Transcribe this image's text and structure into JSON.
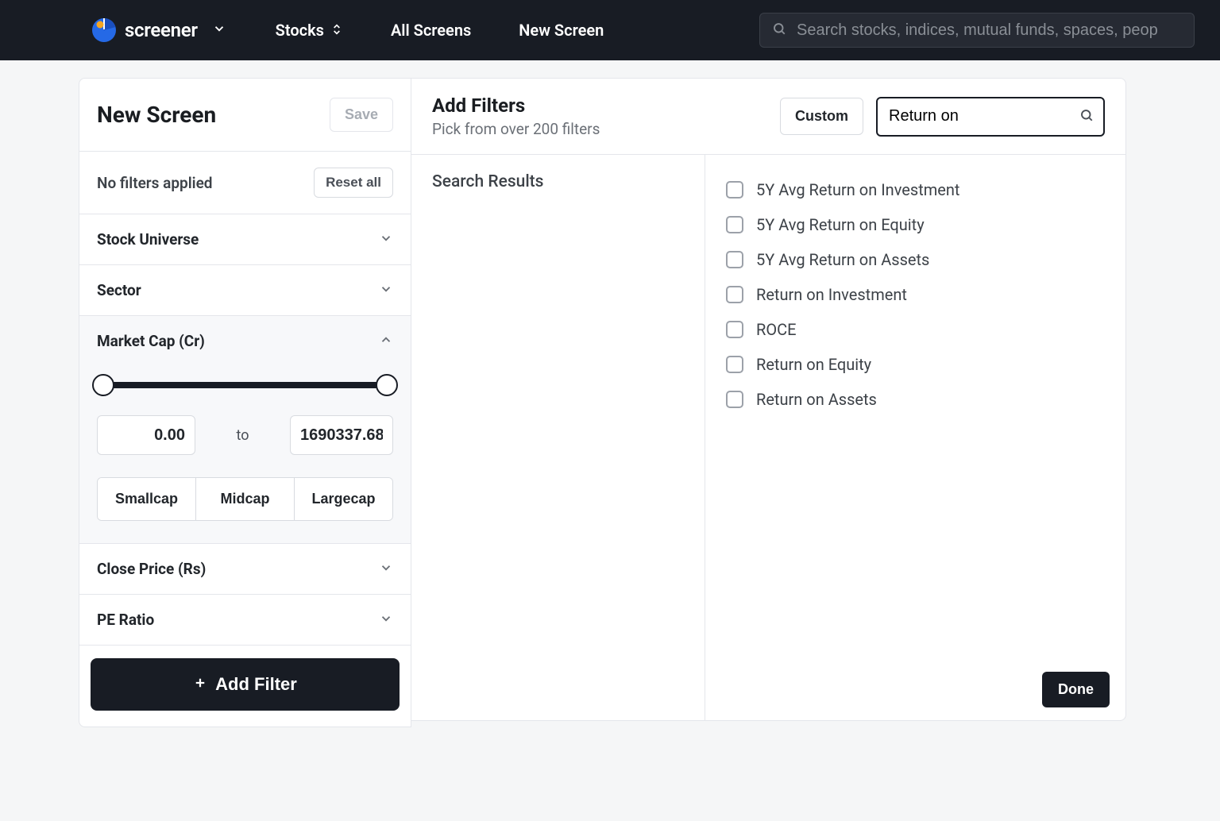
{
  "brand": "screener",
  "nav": {
    "stocks": "Stocks",
    "all_screens": "All Screens",
    "new_screen": "New Screen"
  },
  "search_placeholder": "Search stocks, indices, mutual funds, spaces, peop",
  "left": {
    "title": "New Screen",
    "save": "Save",
    "no_filters": "No filters applied",
    "reset": "Reset all",
    "sections": {
      "stock_universe": "Stock Universe",
      "sector": "Sector",
      "market_cap": "Market Cap (Cr)",
      "close_price": "Close Price (Rs)",
      "pe_ratio": "PE Ratio"
    },
    "range": {
      "min": "0.00",
      "to": "to",
      "max": "1690337.68"
    },
    "cap_buttons": [
      "Smallcap",
      "Midcap",
      "Largecap"
    ],
    "add_filter": "Add Filter"
  },
  "right": {
    "title": "Add Filters",
    "subtitle": "Pick from over 200 filters",
    "custom": "Custom",
    "search_value": "Return on ",
    "search_results_label": "Search Results",
    "filters": [
      "5Y Avg Return on Investment",
      "5Y Avg Return on Equity",
      "5Y Avg Return on Assets",
      "Return on Investment",
      "ROCE",
      "Return on Equity",
      "Return on Assets"
    ],
    "done": "Done"
  }
}
